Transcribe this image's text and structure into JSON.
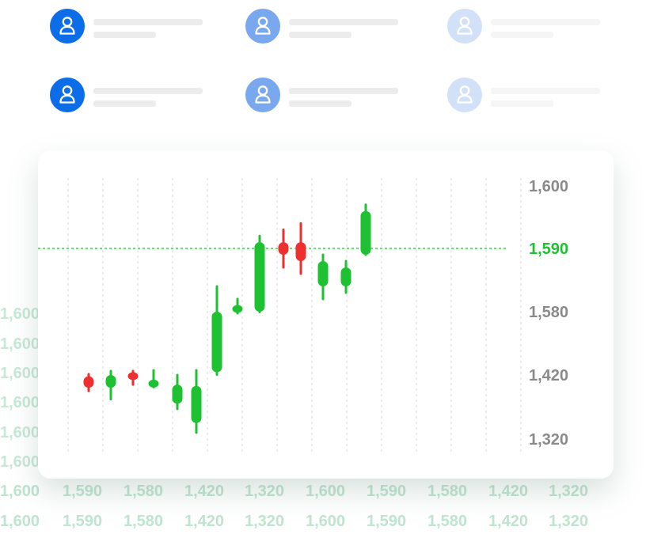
{
  "users": [
    {
      "avatar": "user-icon",
      "color": "#0b6ee8",
      "skeleton_color": "#ececec"
    },
    {
      "avatar": "user-icon",
      "color": "#7aa8ee",
      "skeleton_color": "#ececec"
    },
    {
      "avatar": "user-icon",
      "color": "#d3e1f8",
      "skeleton_color": "#f5f5f5"
    },
    {
      "avatar": "user-icon",
      "color": "#0b6ee8",
      "skeleton_color": "#ececec"
    },
    {
      "avatar": "user-icon",
      "color": "#7aa8ee",
      "skeleton_color": "#ececec"
    },
    {
      "avatar": "user-icon",
      "color": "#d3e1f8",
      "skeleton_color": "#f5f5f5"
    }
  ],
  "background_ticks": {
    "left": [
      "1,600",
      "1,600",
      "1,600",
      "1,600",
      "1,600",
      "1,600"
    ],
    "bottom_rows": [
      [
        "1,600",
        "1,590",
        "1,580",
        "1,420",
        "1,320",
        "1,600",
        "1,590",
        "1,580",
        "1,420",
        "1,320"
      ],
      [
        "1,600",
        "1,590",
        "1,580",
        "1,420",
        "1,320",
        "1,600",
        "1,590",
        "1,580",
        "1,420",
        "1,320"
      ]
    ]
  },
  "chart_data": {
    "type": "candlestick",
    "y_tick_labels": [
      "1,600",
      "1,590",
      "1,580",
      "1,420",
      "1,320"
    ],
    "highlighted_tick": "1,590",
    "reference_line": "1,590",
    "grid": "vertical dashed",
    "colors": {
      "up": "#1ec132",
      "down": "#ee2f2f",
      "highlight": "#1ec132",
      "axis": "#8a8a8a"
    },
    "candles": [
      {
        "dir": "down",
        "open": 1418,
        "close": 1400,
        "high": 1422,
        "low": 1395
      },
      {
        "dir": "up",
        "open": 1400,
        "close": 1420,
        "high": 1430,
        "low": 1382
      },
      {
        "dir": "down",
        "open": 1424,
        "close": 1414,
        "high": 1430,
        "low": 1405
      },
      {
        "dir": "up",
        "open": 1401,
        "close": 1412,
        "high": 1432,
        "low": 1401
      },
      {
        "dir": "up",
        "open": 1375,
        "close": 1405,
        "high": 1420,
        "low": 1367
      },
      {
        "dir": "up",
        "open": 1345,
        "close": 1403,
        "high": 1432,
        "low": 1330
      },
      {
        "dir": "up",
        "open": 1427,
        "close": 1580,
        "high": 1584,
        "low": 1421
      },
      {
        "dir": "up",
        "open": 1578,
        "close": 1581,
        "high": 1582,
        "low": 1576
      },
      {
        "dir": "up",
        "open": 1580,
        "close": 1591,
        "high": 1592,
        "low": 1579
      },
      {
        "dir": "down",
        "open": 1591,
        "close": 1589,
        "high": 1593,
        "low": 1587
      },
      {
        "dir": "down",
        "open": 1591,
        "close": 1588,
        "high": 1594,
        "low": 1586
      },
      {
        "dir": "up",
        "open": 1584,
        "close": 1588,
        "high": 1589,
        "low": 1582
      },
      {
        "dir": "up",
        "open": 1584,
        "close": 1587,
        "high": 1588,
        "low": 1583
      },
      {
        "dir": "up",
        "open": 1589,
        "close": 1596,
        "high": 1597,
        "low": 1589
      }
    ]
  }
}
